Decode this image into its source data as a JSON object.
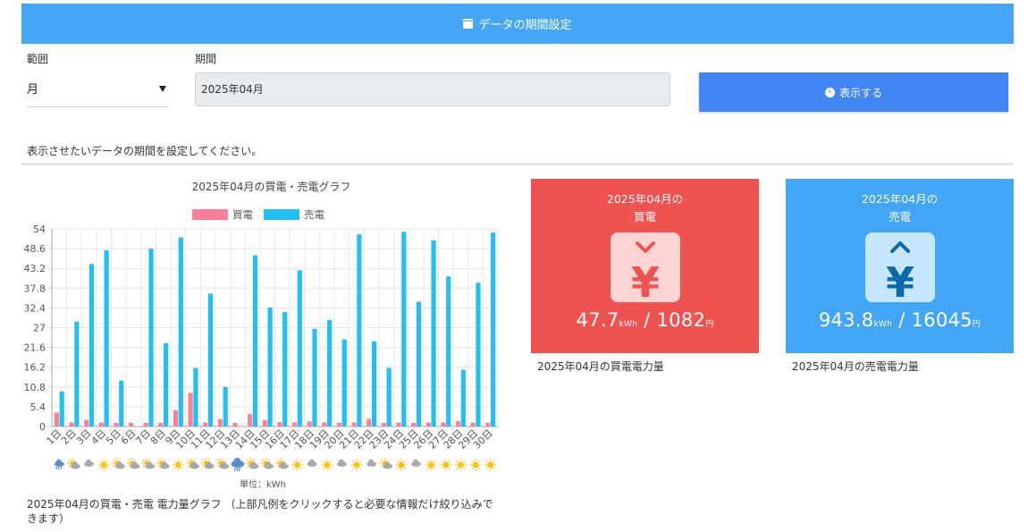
{
  "header": {
    "title": "データの期間設定",
    "icon": "calendar-icon"
  },
  "form": {
    "range_label": "範囲",
    "range_value": "月",
    "period_label": "期間",
    "period_value": "2025年04月",
    "show_button": "表示する",
    "instruction": "表示させたいデータの期間を設定してください。"
  },
  "chart_data": {
    "type": "bar",
    "title": "2025年04月の買電・売電グラフ",
    "legend_position": "top",
    "grid": true,
    "categories": [
      "1日",
      "2日",
      "3日",
      "4日",
      "5日",
      "6日",
      "7日",
      "8日",
      "9日",
      "10日",
      "11日",
      "12日",
      "13日",
      "14日",
      "15日",
      "16日",
      "17日",
      "18日",
      "19日",
      "20日",
      "21日",
      "22日",
      "23日",
      "24日",
      "25日",
      "26日",
      "27日",
      "28日",
      "29日",
      "30日"
    ],
    "series": [
      {
        "name": "買電",
        "color": "#ff8095",
        "values": [
          3.8,
          1.1,
          1.8,
          1.1,
          1.0,
          1.0,
          1.0,
          1.0,
          4.4,
          9.2,
          1.1,
          2.0,
          1.0,
          3.4,
          1.7,
          1.2,
          1.1,
          1.4,
          1.1,
          1.0,
          1.1,
          2.1,
          1.0,
          1.1,
          1.0,
          1.1,
          1.1,
          1.5,
          1.0,
          1.0
        ]
      },
      {
        "name": "売電",
        "color": "#22bff5",
        "values": [
          9.6,
          28.7,
          44.4,
          48.2,
          12.5,
          0,
          48.6,
          22.8,
          51.7,
          16.0,
          36.3,
          10.8,
          0,
          46.8,
          32.5,
          31.3,
          42.7,
          26.7,
          29.1,
          23.8,
          52.5,
          23.3,
          16.0,
          53.2,
          34.1,
          50.9,
          41.0,
          15.5,
          39.3,
          53.0
        ]
      }
    ],
    "ylim": [
      0,
      54
    ],
    "yticks": [
      "0",
      "5.4",
      "10.8",
      "16.2",
      "21.6",
      "27",
      "32.4",
      "37.8",
      "43.2",
      "48.6",
      "54"
    ],
    "weather_icons": [
      "cloud-rain",
      "sun-cloud",
      "cloud",
      "sun",
      "sun-cloud",
      "sun-cloud",
      "sun-cloud",
      "sun-cloud",
      "sun",
      "sun-cloud",
      "sun-cloud",
      "sun-cloud",
      "rain",
      "sun-cloud",
      "sun-cloud",
      "sun-cloud",
      "sun",
      "cloud",
      "sun",
      "cloud",
      "sun",
      "cloud",
      "sun-cloud",
      "sun",
      "cloud",
      "sun",
      "sun",
      "sun",
      "sun",
      "sun"
    ],
    "unit_label": "単位：kWh"
  },
  "caption": "2025年04月の買電・売電 電力量グラフ （上部凡例をクリックすると必要な情報だけ絞り込みできます）",
  "cards": {
    "buy": {
      "title_line1": "2025年04月の",
      "title_line2": "買電",
      "kwh": "47.7",
      "kwh_unit": "kWh",
      "sep": " / ",
      "yen": "1082",
      "yen_unit": "円",
      "color": "#ef5350",
      "icon": "yen-down-icon",
      "subtitle": "2025年04月の買電電力量"
    },
    "sell": {
      "title_line1": "2025年04月の",
      "title_line2": "売電",
      "kwh": "943.8",
      "kwh_unit": "kWh",
      "sep": " / ",
      "yen": "16045",
      "yen_unit": "円",
      "color": "#42a5f5",
      "icon": "yen-up-icon",
      "subtitle": "2025年04月の売電電力量"
    }
  }
}
